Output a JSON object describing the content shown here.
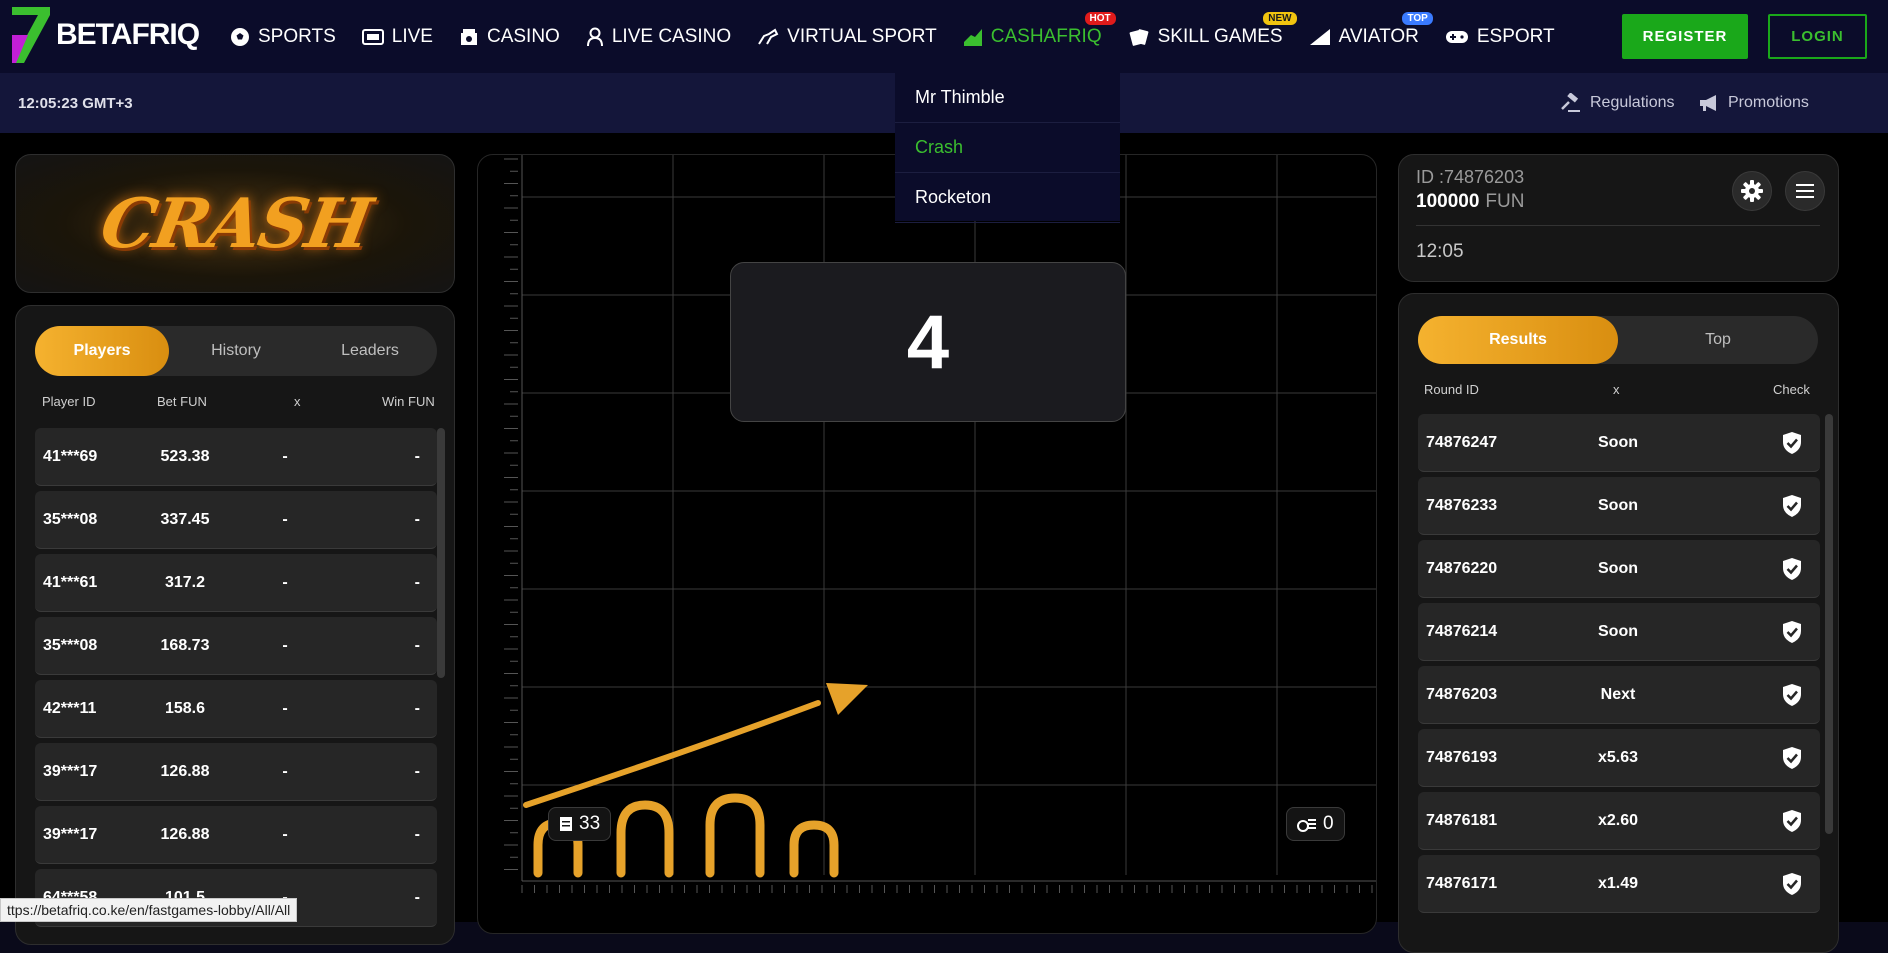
{
  "brand": {
    "name": "BETAFRIQ",
    "mark_color": "#7a2ff0",
    "accent_color": "#3bbf2f"
  },
  "nav": [
    {
      "label": "SPORTS",
      "icon": "soccer-ball-icon"
    },
    {
      "label": "LIVE",
      "icon": "live-tv-icon"
    },
    {
      "label": "CASINO",
      "icon": "casino-chip-icon"
    },
    {
      "label": "LIVE CASINO",
      "icon": "dealer-icon"
    },
    {
      "label": "VIRTUAL SPORT",
      "icon": "horse-icon"
    },
    {
      "label": "CASHAFRIQ",
      "icon": "rising-chart-icon",
      "badge": "HOT",
      "active": true
    },
    {
      "label": "SKILL GAMES",
      "icon": "cards-icon",
      "badge": "NEW"
    },
    {
      "label": "AVIATOR",
      "icon": "plane-icon",
      "badge": "TOP"
    },
    {
      "label": "ESPORT",
      "icon": "gamepad-icon"
    }
  ],
  "auth": {
    "register": "REGISTER",
    "login": "LOGIN"
  },
  "subbar": {
    "time": "12:05:23 GMT+3",
    "regulations": "Regulations",
    "promotions": "Promotions"
  },
  "dropdown": [
    {
      "label": "Mr Thimble",
      "active": false
    },
    {
      "label": "Crash",
      "active": true
    },
    {
      "label": "Rocketon",
      "active": false
    }
  ],
  "game_logo": "CRASH",
  "players": {
    "tabs": [
      "Players",
      "History",
      "Leaders"
    ],
    "active_tab": 0,
    "columns": [
      "Player ID",
      "Bet  FUN",
      "x",
      "Win  FUN"
    ],
    "rows": [
      {
        "id": "41***69",
        "bet": "523.38",
        "x": "-",
        "win": "-"
      },
      {
        "id": "35***08",
        "bet": "337.45",
        "x": "-",
        "win": "-"
      },
      {
        "id": "41***61",
        "bet": "317.2",
        "x": "-",
        "win": "-"
      },
      {
        "id": "35***08",
        "bet": "168.73",
        "x": "-",
        "win": "-"
      },
      {
        "id": "42***11",
        "bet": "158.6",
        "x": "-",
        "win": "-"
      },
      {
        "id": "39***17",
        "bet": "126.88",
        "x": "-",
        "win": "-"
      },
      {
        "id": "39***17",
        "bet": "126.88",
        "x": "-",
        "win": "-"
      },
      {
        "id": "64***58",
        "bet": "101.5",
        "x": "-",
        "win": "-"
      }
    ]
  },
  "game": {
    "countdown": "4",
    "bets_count": "33",
    "cashout_count": "0"
  },
  "account": {
    "id": "ID :74876203",
    "balance": "100000",
    "currency": "FUN",
    "time": "12:05"
  },
  "results": {
    "tabs": [
      "Results",
      "Top"
    ],
    "active_tab": 0,
    "columns": [
      "Round ID",
      "x",
      "Check"
    ],
    "rows": [
      {
        "round": "74876247",
        "x": "Soon"
      },
      {
        "round": "74876233",
        "x": "Soon"
      },
      {
        "round": "74876220",
        "x": "Soon"
      },
      {
        "round": "74876214",
        "x": "Soon"
      },
      {
        "round": "74876203",
        "x": "Next"
      },
      {
        "round": "74876193",
        "x": "x5.63"
      },
      {
        "round": "74876181",
        "x": "x2.60"
      },
      {
        "round": "74876171",
        "x": "x1.49"
      }
    ]
  },
  "status_url": "ttps://betafriq.co.ke/en/fastgames-lobby/All/All"
}
